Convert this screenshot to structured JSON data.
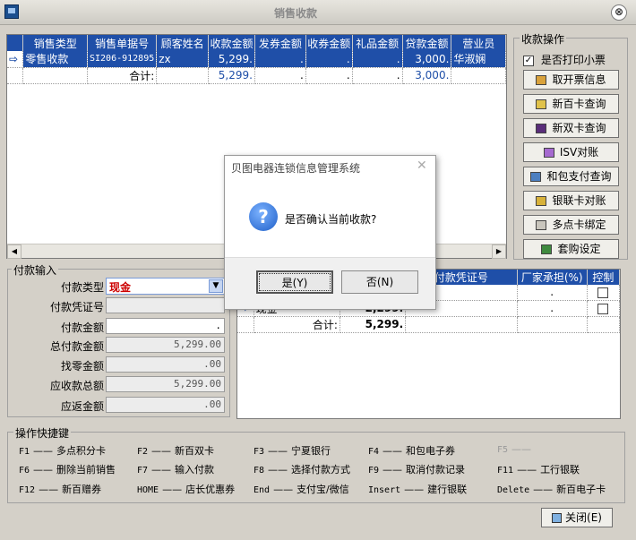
{
  "window": {
    "title": "销售收款",
    "close_glyph": "⊗"
  },
  "grid": {
    "headers": [
      "销售类型",
      "销售单据号",
      "顾客姓名",
      "收款金额",
      "发券金额",
      "收券金额",
      "礼品金额",
      "贷款金额",
      "营业员"
    ],
    "rows": [
      {
        "type": "零售收款",
        "doc": "SI206-912895",
        "customer": "zx",
        "amount": "5,299.",
        "coupon_out": ".",
        "coupon_in": ".",
        "gift": ".",
        "loan": "3,000.",
        "clerk": "华淑娴"
      },
      {
        "type": "",
        "doc": "合计:",
        "customer": "",
        "amount": "5,299.",
        "coupon_out": ".",
        "coupon_in": ".",
        "gift": ".",
        "loan": "3,000.",
        "clerk": ""
      }
    ],
    "row_marker": "⇨"
  },
  "ops": {
    "title": "收款操作",
    "print_receipt_label": "是否打印小票",
    "print_receipt_checked": true,
    "buttons": [
      "取开票信息",
      "新百卡查询",
      "新双卡查询",
      "ISV对账",
      "和包支付查询",
      "银联卡对账",
      "多点卡绑定",
      "套购设定"
    ]
  },
  "payment": {
    "title": "付款输入",
    "pay_type_label": "付款类型",
    "pay_type_value": "现金",
    "voucher_label": "付款凭证号",
    "voucher_value": "",
    "pay_amount_label": "付款金额",
    "pay_amount_value": ".",
    "total_pay_label": "总付款金额",
    "total_pay_value": "5,299.00",
    "change_label": "找零金额",
    "change_value": ".00",
    "receivable_label": "应收款总额",
    "receivable_value": "5,299.00",
    "refund_label": "应返金额",
    "refund_value": ".00"
  },
  "paygrid": {
    "headers": [
      "付款凭证号",
      "厂家承担(%)",
      "控制"
    ],
    "rows": [
      {
        "method": "",
        "amount": "",
        "pct": "."
      },
      {
        "method": "现金",
        "amount": "2,299.",
        "pct": "."
      },
      {
        "method": "合计:",
        "amount": "5,299.",
        "pct": ""
      }
    ]
  },
  "shortcuts": {
    "title": "操作快捷键",
    "items": [
      {
        "key": "F1",
        "label": "多点积分卡"
      },
      {
        "key": "F2",
        "label": "新百双卡"
      },
      {
        "key": "F3",
        "label": "宁夏银行"
      },
      {
        "key": "F4",
        "label": "和包电子券"
      },
      {
        "key": "F5",
        "label": ""
      },
      {
        "key": "F6",
        "label": "删除当前销售"
      },
      {
        "key": "F7",
        "label": "输入付款"
      },
      {
        "key": "F8",
        "label": "选择付款方式"
      },
      {
        "key": "F9",
        "label": "取消付款记录"
      },
      {
        "key": "F11",
        "label": "工行银联"
      },
      {
        "key": "F12",
        "label": "新百赠券"
      },
      {
        "key": "HOME",
        "label": "店长优惠券"
      },
      {
        "key": "End",
        "label": "支付宝/微信"
      },
      {
        "key": "Insert",
        "label": "建行银联"
      },
      {
        "key": "Delete",
        "label": "新百电子卡"
      }
    ],
    "dash": "——"
  },
  "footer": {
    "close_label": "关闭(E)"
  },
  "dialog": {
    "title": "贝图电器连锁信息管理系统",
    "message": "是否确认当前收款?",
    "yes_label": "是(Y)",
    "no_label": "否(N)",
    "close_glyph": "✕"
  },
  "colors": {
    "header_blue": "#1f4fa8",
    "pay_type_red": "#cc0000"
  }
}
